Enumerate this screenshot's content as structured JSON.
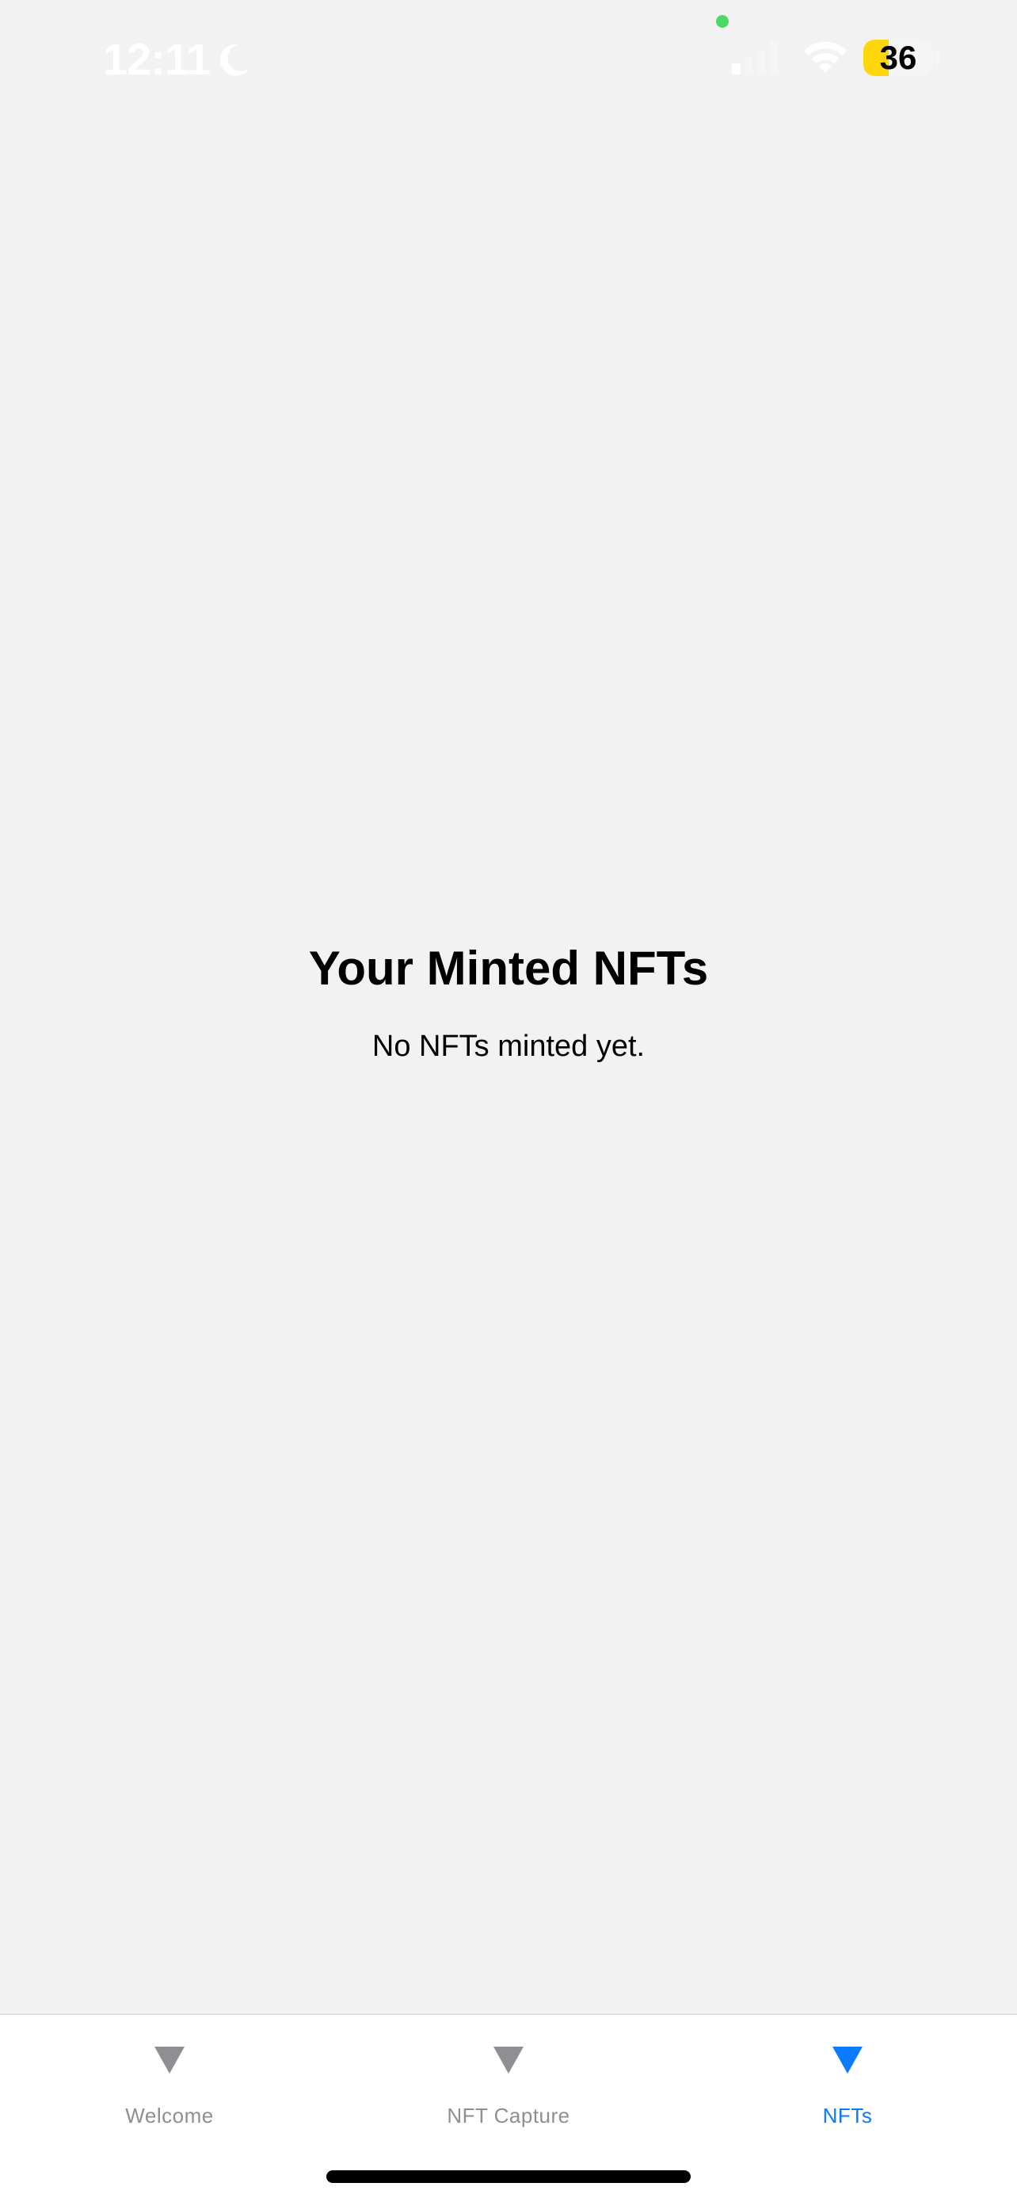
{
  "status_bar": {
    "time": "12:11",
    "battery_level": "36",
    "battery_fraction": 0.36,
    "colors": {
      "privacy_dot": "#4cd964",
      "battery_fill": "#ffd60a",
      "text": "#ffffff"
    },
    "icons": [
      "moon-icon",
      "signal-icon",
      "wifi-icon",
      "battery-icon"
    ]
  },
  "main": {
    "title": "Your Minted NFTs",
    "empty_message": "No NFTs minted yet."
  },
  "tab_bar": {
    "active_color": "#0a7aff",
    "inactive_color": "#8e8e93",
    "tabs": [
      {
        "label": "Welcome",
        "icon": "triangle-icon",
        "active": false
      },
      {
        "label": "NFT Capture",
        "icon": "triangle-icon",
        "active": false
      },
      {
        "label": "NFTs",
        "icon": "triangle-icon",
        "active": true
      }
    ]
  }
}
